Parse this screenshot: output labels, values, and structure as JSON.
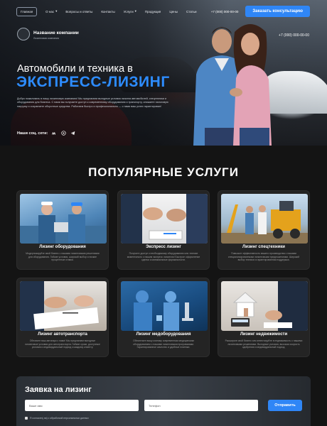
{
  "nav": {
    "items": [
      "Главная",
      "О нас",
      "Вопросы и ответы",
      "Контакты",
      "Услуги",
      "Продукция",
      "Цены",
      "Статьи"
    ],
    "phone": "+7 (000) 000-00-00",
    "cta": "Заказать консультацию"
  },
  "company": {
    "name": "Название компании",
    "subtitle": "Лизинговая компания"
  },
  "hero": {
    "phone": "+7 (000) 000-00-00",
    "title": "Автомобили и техника в",
    "accent": "ЭКСПРЕСС-ЛИЗИНГ",
    "description": "Добро пожаловать в нашу лизинговую компанию! Мы предлагаем выгодные условия лизинга автомобилей, спецтехники и оборудования для бизнеса. С нами вы получаете доступ к современному оборудованию и транспорту, снижаете налоговую нагрузку и сохраняете оборотные средства. Работаем быстро и профессионально — с нами ваш успех гарантирован!",
    "social_label": "Наши соц. сети:"
  },
  "services": {
    "title": "ПОПУЛЯРНЫЕ УСЛУГИ",
    "items": [
      {
        "title": "Лизинг оборудования",
        "text": "Модернизируйте свой бизнес с нашими лизинговыми решениями для оборудования. Гибкие условия, широкий выбор и низкие процентные ставки."
      },
      {
        "title": "Экспресс лизинг",
        "text": "Получите доступ к необходимому оборудованию или технике моментально с нашим экспресс лизингом! Быстрое оформление сделки и минимальные формальности."
      },
      {
        "title": "Лизинг спецтехники",
        "text": "Повысьте эффективность вашего производства с нашими специализированными лизинговыми предложениями. Широкий выбор техники и гарантированная поддержка."
      },
      {
        "title": "Лизинг автотранспорта",
        "text": "Обновите ваш автопарк с нами! Мы предлагаем выгодные лизинговые условия для автотранспорта. Гибкие сроки, доступные условия и индивидуальный подход к каждому клиенту."
      },
      {
        "title": "Лизинг медоборудования",
        "text": "Обеспечьте вашу клинику современным медицинским оборудованием с нашими лизинговыми программами. Гарантированное качество и удобные платежи."
      },
      {
        "title": "Лизинг недвижимости",
        "text": "Расширьте свой бизнес или инвестируйте в недвижимость с нашими лизинговыми решениями. Выгодные условия, высокая скорость одобрения и индивидуальный подход."
      }
    ]
  },
  "form": {
    "title": "Заявка на лизинг",
    "name_placeholder": "Ваше имя",
    "phone_placeholder": "Телефон",
    "submit": "Отправить",
    "consent": "Я согласен(-на) с обработкой персональных данных"
  },
  "colors": {
    "accent": "#2f86f6",
    "headline_accent": "#2d8cff",
    "page_bg": "#141414",
    "card_bg": "#242424"
  }
}
